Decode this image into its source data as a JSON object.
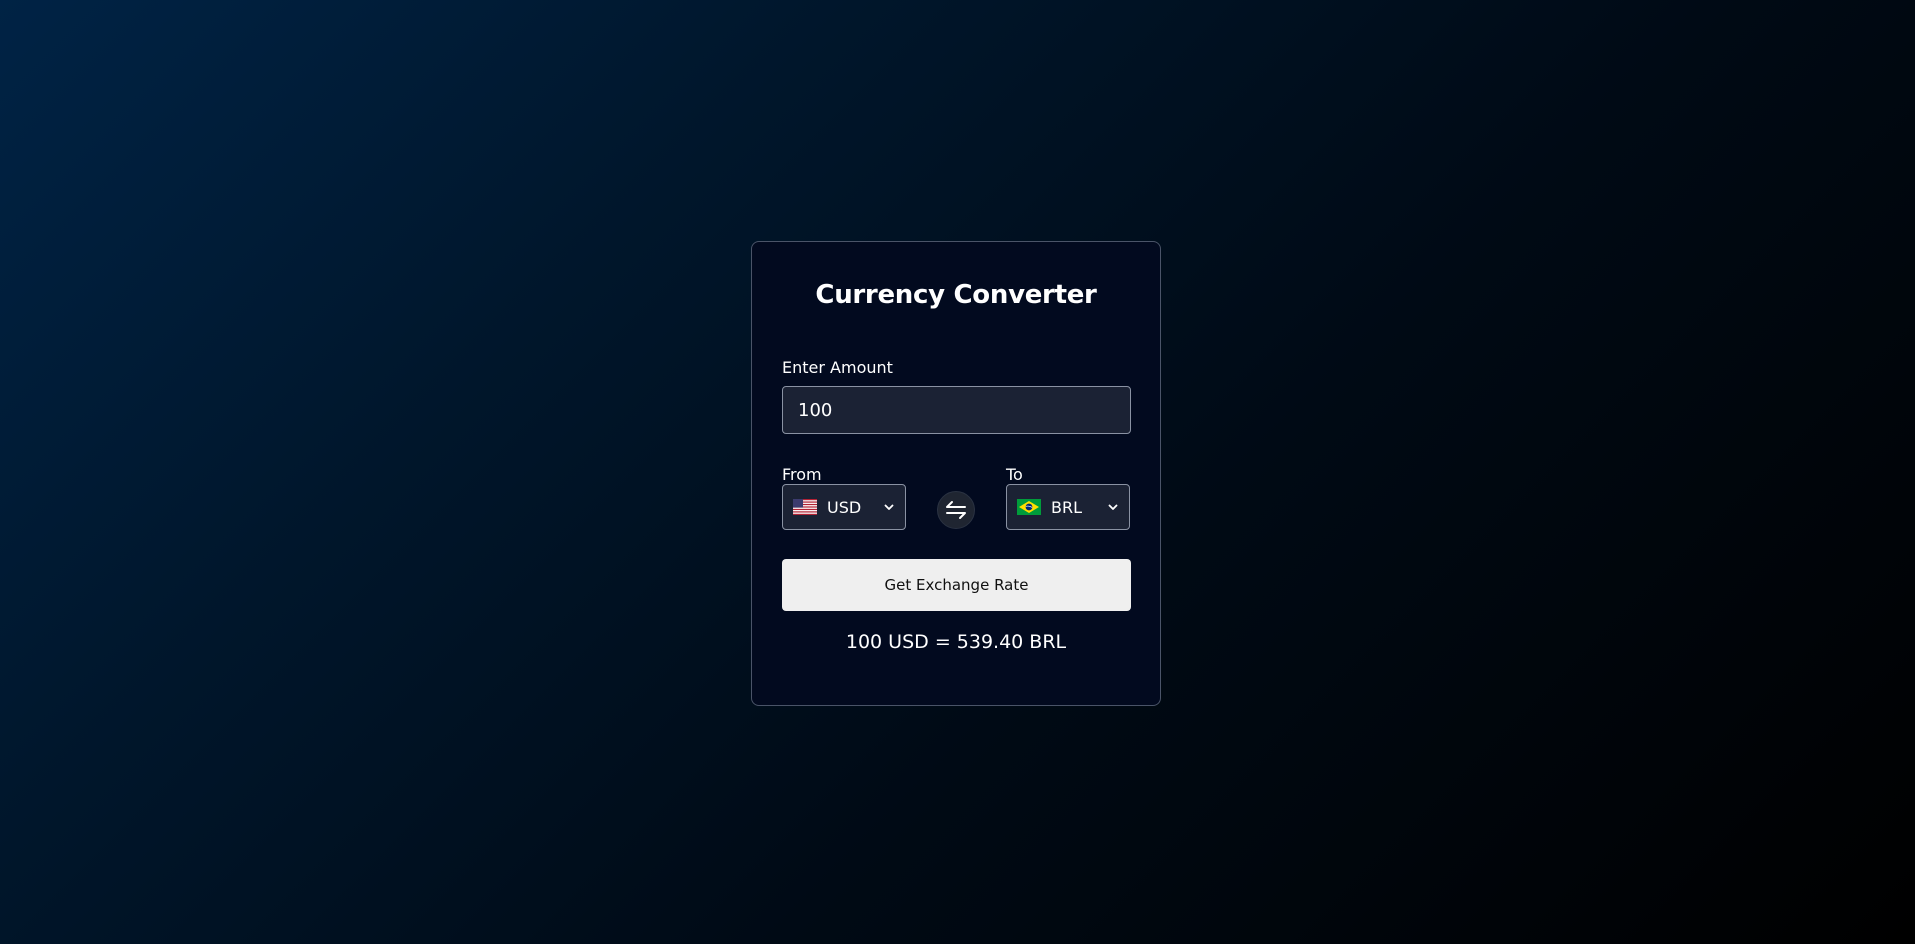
{
  "title": "Currency Converter",
  "amount": {
    "label": "Enter Amount",
    "value": "100"
  },
  "from": {
    "label": "From",
    "currency": "USD",
    "flag_icon": "us-flag-icon"
  },
  "to": {
    "label": "To",
    "currency": "BRL",
    "flag_icon": "brazil-flag-icon"
  },
  "swap_icon": "swap-arrows-icon",
  "button": {
    "label": "Get Exchange Rate"
  },
  "result": {
    "text": "100 USD = 539.40 BRL"
  },
  "colors": {
    "card_background": "#020a1f",
    "input_background": "#1b2234",
    "button_background": "#efefef",
    "text": "#ffffff"
  }
}
